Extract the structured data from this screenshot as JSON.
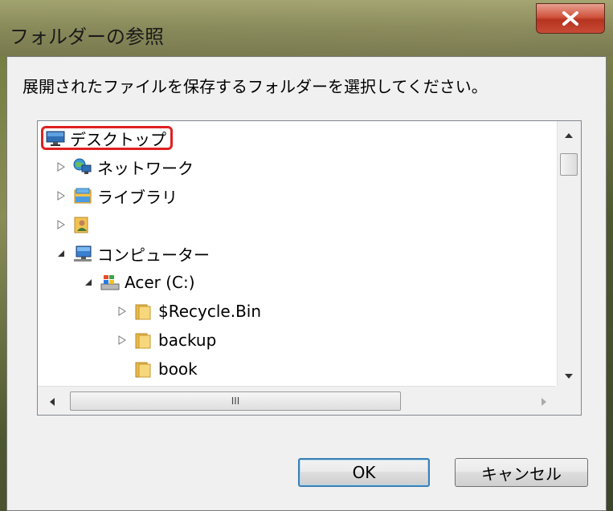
{
  "window": {
    "title": "フォルダーの参照",
    "close_label": "x"
  },
  "instruction": "展開されたファイルを保存するフォルダーを選択してください。",
  "tree": {
    "items": [
      {
        "label": "デスクトップ",
        "icon": "desktop-icon",
        "expander": "",
        "selected_highlight": true
      },
      {
        "label": "ネットワーク",
        "icon": "network-icon",
        "expander": "▷"
      },
      {
        "label": "ライブラリ",
        "icon": "library-icon",
        "expander": "▷"
      },
      {
        "label": "",
        "icon": "user-folder-icon",
        "expander": "▷"
      },
      {
        "label": "コンピューター",
        "icon": "computer-icon",
        "expander": "◢"
      },
      {
        "label": "Acer (C:)",
        "icon": "drive-icon",
        "expander": "◢"
      },
      {
        "label": "$Recycle.Bin",
        "icon": "folder-icon",
        "expander": "▷"
      },
      {
        "label": "backup",
        "icon": "folder-icon",
        "expander": "▷"
      },
      {
        "label": "book",
        "icon": "folder-icon",
        "expander": ""
      }
    ],
    "hscroll_grip": "III"
  },
  "buttons": {
    "ok": "OK",
    "cancel": "キャンセル"
  }
}
